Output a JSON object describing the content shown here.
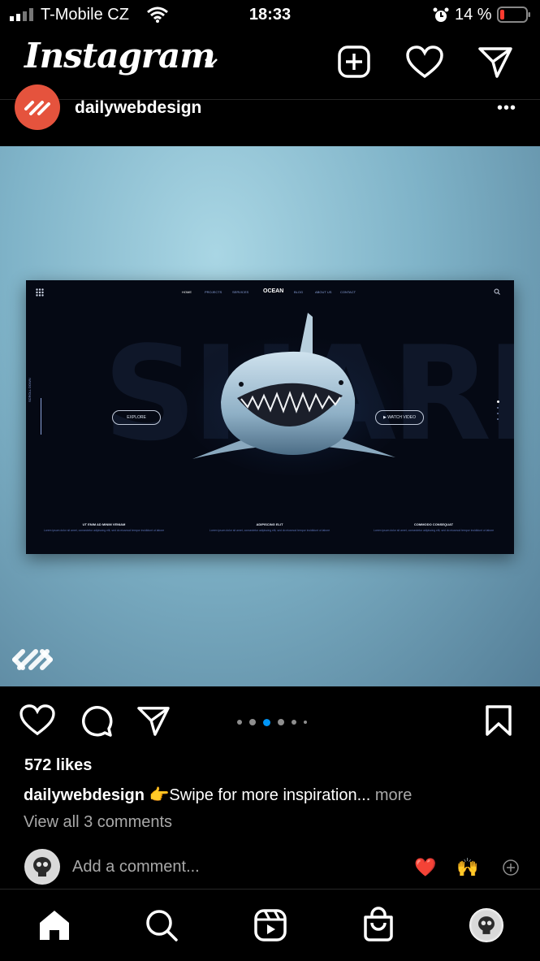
{
  "status_bar": {
    "carrier": "T-Mobile CZ",
    "time": "18:33",
    "battery": "14 %"
  },
  "header": {
    "logo": "Instagram",
    "icons": [
      "chevron-down-icon",
      "new-post-icon",
      "heart-icon",
      "direct-message-icon"
    ]
  },
  "post": {
    "username": "dailywebdesign",
    "more_label": "•••",
    "image": {
      "nav": {
        "brand": "OCEAN",
        "items": [
          "HOME",
          "PROJECTS",
          "SERVICES",
          "BLOG",
          "ABOUT US",
          "CONTACT"
        ]
      },
      "side_label": "SCROLL DOWN",
      "big_word": "SHARK",
      "explore": "EXPLORE",
      "watch_video": "WATCH VIDEO",
      "features": [
        {
          "title": "UT ENIM AD MINIM VENIAM",
          "text": "Lorem ipsum dolor sit amet, consectetur adipiscing elit, sed do eiusmod tempor incididunt ut labore"
        },
        {
          "title": "ADIPISCING ELIT",
          "text": "Lorem ipsum dolor sit amet, consectetur adipiscing elit, sed do eiusmod tempor incididunt ut labore"
        },
        {
          "title": "COMMODO CONSEQUAT",
          "text": "Lorem ipsum dolor sit amet, consectetur adipiscing elit, sed do eiusmod tempor incididunt ut labore"
        }
      ]
    },
    "carousel": {
      "count": 6,
      "active_index": 2
    },
    "likes": "572 likes",
    "caption": {
      "username": "dailywebdesign",
      "emoji": "👉",
      "text": "Swipe for more inspiration...",
      "more": "more"
    },
    "view_comments": "View all 3 comments",
    "comment_placeholder": "Add a comment...",
    "quick_reactions": [
      "❤️",
      "🙌"
    ]
  },
  "tab_bar": {
    "items": [
      "home-icon",
      "search-icon",
      "reels-icon",
      "shop-icon",
      "profile-avatar"
    ]
  },
  "colors": {
    "background": "#000000",
    "accent_blue": "#0095f6",
    "brand_avatar": "#e5533d",
    "secondary_text": "#a8a8a8",
    "battery_low": "#ff3b30"
  }
}
